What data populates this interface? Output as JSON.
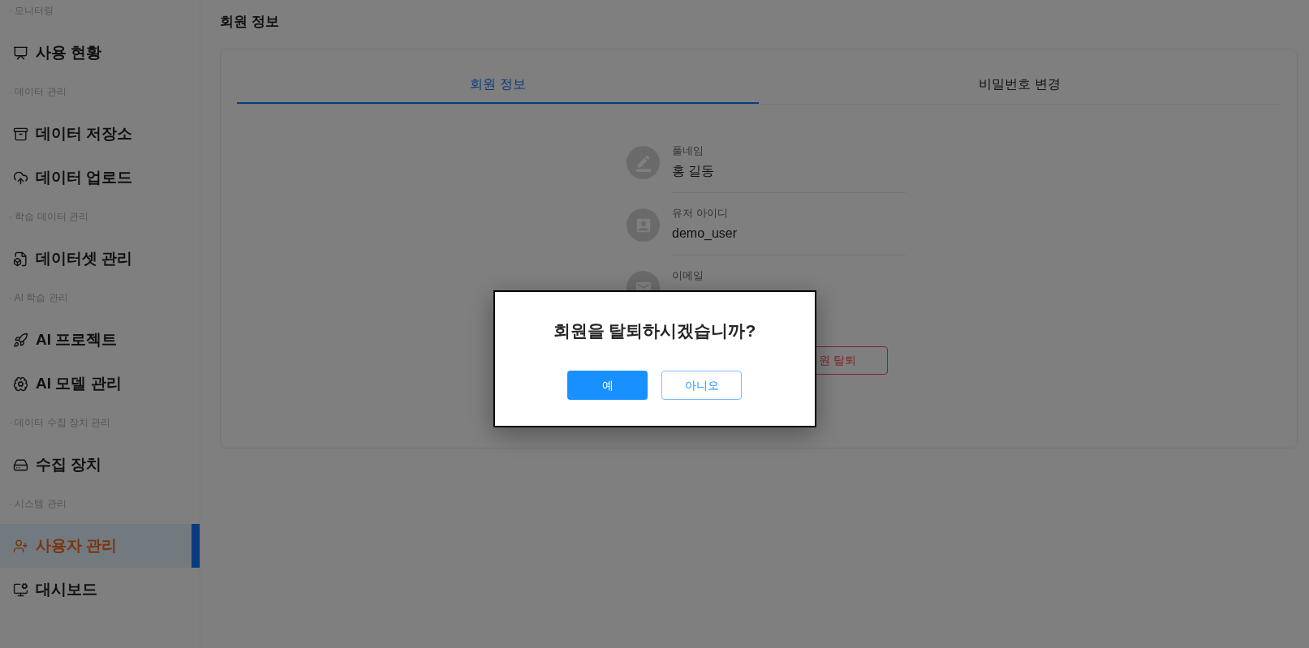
{
  "sidebar": {
    "sections": [
      {
        "label": "· 모니터링",
        "items": [
          {
            "label": "사용 현황",
            "selected": false
          }
        ]
      },
      {
        "label": "· 데이터 관리",
        "items": [
          {
            "label": "데이터 저장소",
            "selected": false
          },
          {
            "label": "데이터 업로드",
            "selected": false
          }
        ]
      },
      {
        "label": "· 학습 데이터 관리",
        "items": [
          {
            "label": "데이터셋 관리",
            "selected": false
          }
        ]
      },
      {
        "label": "· AI 학습 관리",
        "items": [
          {
            "label": "AI 프로젝트",
            "selected": false
          },
          {
            "label": "AI 모델 관리",
            "selected": false
          }
        ]
      },
      {
        "label": "· 데이터 수집 장치 관리",
        "items": [
          {
            "label": "수집 장치",
            "selected": false
          }
        ]
      },
      {
        "label": "· 시스템 관리",
        "items": [
          {
            "label": "사용자 관리",
            "selected": true
          },
          {
            "label": "대시보드",
            "selected": false
          }
        ]
      }
    ]
  },
  "page": {
    "title": "회원 정보"
  },
  "tabs": [
    {
      "label": "회원 정보",
      "selected": true
    },
    {
      "label": "비밀번호 변경",
      "selected": false
    }
  ],
  "profile": {
    "fields": [
      {
        "label": "풀네임",
        "value": "홍 길동"
      },
      {
        "label": "유저 아이디",
        "value": "demo_user"
      },
      {
        "label": "이메일"
      }
    ]
  },
  "withdraw_button": {
    "label": "원 탈퇴"
  },
  "dialog": {
    "message": "회원을 탈퇴하시겠습니까?",
    "buttons": [
      {
        "label": "예",
        "kind": "primary"
      },
      {
        "label": "아니오",
        "kind": "outline"
      }
    ]
  }
}
